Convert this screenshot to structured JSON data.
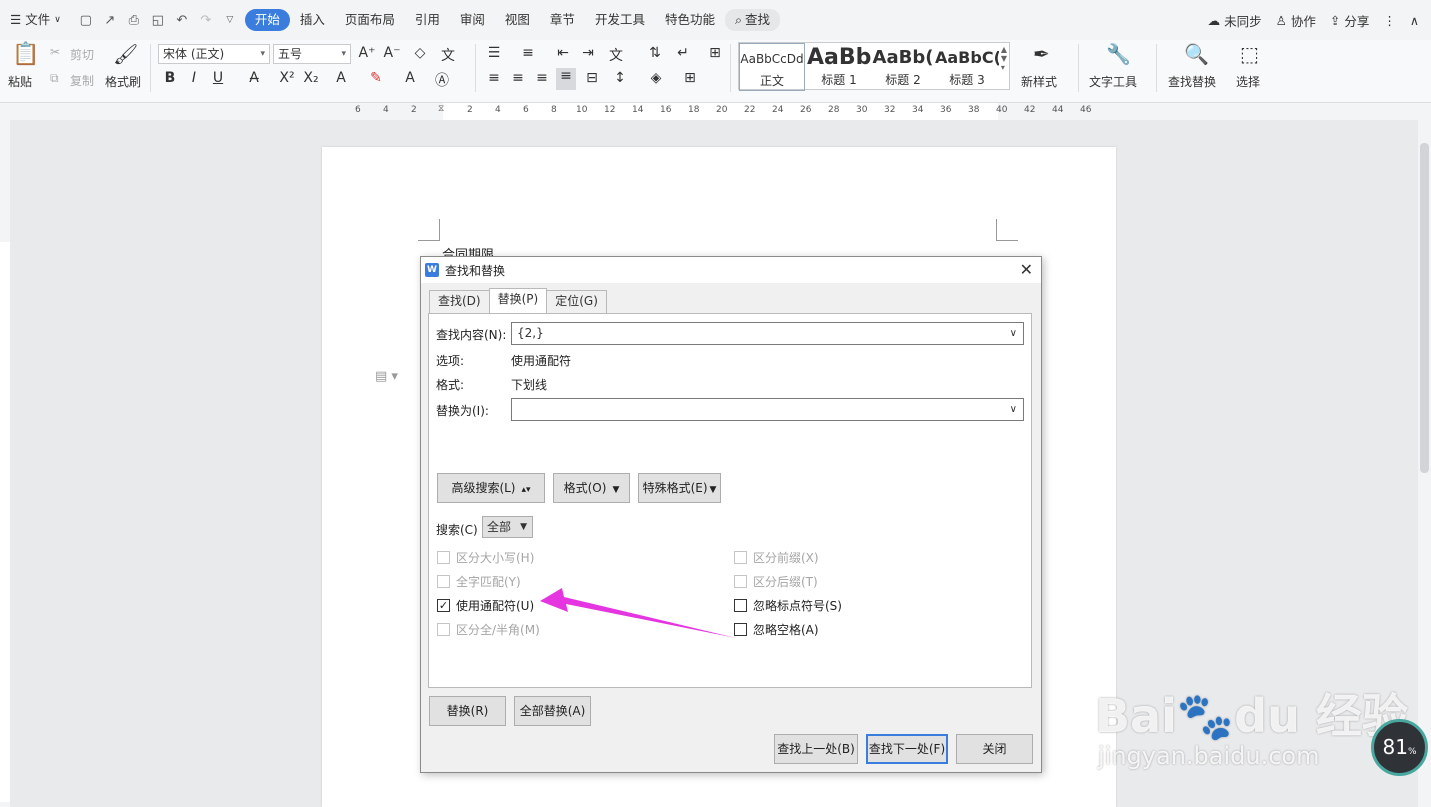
{
  "menubar": {
    "file_label": "文件",
    "items": [
      "开始",
      "插入",
      "页面布局",
      "引用",
      "审阅",
      "视图",
      "章节",
      "开发工具",
      "特色功能"
    ],
    "active_index": 0,
    "search_label": "查找",
    "right": {
      "sync": "未同步",
      "collab": "协作",
      "share": "分享"
    }
  },
  "ribbon": {
    "paste": "粘贴",
    "cut": "剪切",
    "copy": "复制",
    "format_painter": "格式刷",
    "font_name": "宋体 (正文)",
    "font_size": "五号",
    "styles": [
      {
        "preview": "AaBbCcDd",
        "label": "正文"
      },
      {
        "preview": "AaBb",
        "label": "标题 1"
      },
      {
        "preview": "AaBb(",
        "label": "标题 2"
      },
      {
        "preview": "AaBbC(",
        "label": "标题 3"
      }
    ],
    "new_style": "新样式",
    "text_tools": "文字工具",
    "find_replace": "查找替换",
    "select": "选择"
  },
  "ruler": {
    "numbers": [
      "6",
      "4",
      "2",
      "2",
      "4",
      "6",
      "8",
      "10",
      "12",
      "14",
      "16",
      "18",
      "20",
      "22",
      "24",
      "26",
      "28",
      "30",
      "32",
      "34",
      "36",
      "38",
      "40",
      "42",
      "44",
      "46"
    ]
  },
  "document": {
    "text": "合同期限"
  },
  "dialog": {
    "title": "查找和替换",
    "tabs": [
      "查找(D)",
      "替换(P)",
      "定位(G)"
    ],
    "active_tab": 1,
    "find_label": "查找内容(N):",
    "find_value": "{2,}",
    "options_label": "选项:",
    "options_value": "使用通配符",
    "format_label": "格式:",
    "format_value": "下划线",
    "replace_label": "替换为(I):",
    "replace_value": "",
    "advanced_button": "高级搜索(L)",
    "format_button": "格式(O)",
    "special_button": "特殊格式(E)",
    "search_label": "搜索(C)",
    "search_value": "全部",
    "checkboxes_left": [
      {
        "label": "区分大小写(H)",
        "checked": false,
        "enabled": false
      },
      {
        "label": "全字匹配(Y)",
        "checked": false,
        "enabled": false
      },
      {
        "label": "使用通配符(U)",
        "checked": true,
        "enabled": true
      },
      {
        "label": "区分全/半角(M)",
        "checked": false,
        "enabled": false
      }
    ],
    "checkboxes_right": [
      {
        "label": "区分前缀(X)",
        "checked": false,
        "enabled": false
      },
      {
        "label": "区分后缀(T)",
        "checked": false,
        "enabled": false
      },
      {
        "label": "忽略标点符号(S)",
        "checked": false,
        "enabled": true
      },
      {
        "label": "忽略空格(A)",
        "checked": false,
        "enabled": true
      }
    ],
    "replace_button": "替换(R)",
    "replace_all_button": "全部替换(A)",
    "find_prev_button": "查找上一处(B)",
    "find_next_button": "查找下一处(F)",
    "close_button": "关闭"
  },
  "annotation": {
    "arrow_color": "#e535e0"
  },
  "watermark": {
    "brand": "Bai",
    "brand2": "du",
    "cn": "经验",
    "url": "jingyan.baidu.com"
  },
  "zoom": {
    "value": "81",
    "unit": "%"
  }
}
